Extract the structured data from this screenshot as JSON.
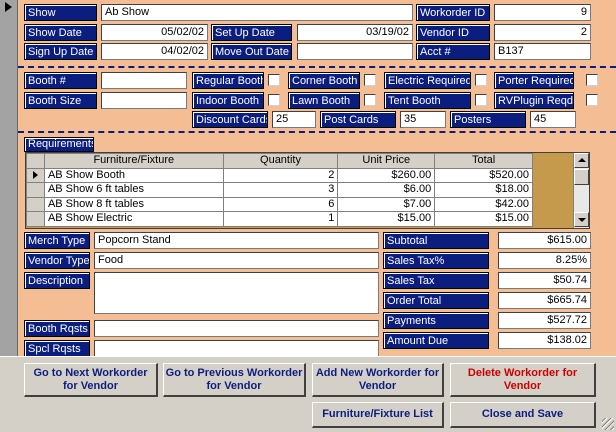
{
  "header": {
    "show_label": "Show",
    "show_value": "Ab Show",
    "workorder_id_label": "Workorder ID",
    "workorder_id_value": "9",
    "show_date_label": "Show Date",
    "show_date_value": "05/02/02",
    "setup_date_label": "Set Up Date",
    "setup_date_value": "03/19/02",
    "vendor_id_label": "Vendor ID",
    "vendor_id_value": "2",
    "signup_date_label": "Sign Up Date",
    "signup_date_value": "04/02/02",
    "moveout_date_label": "Move Out Date",
    "moveout_date_value": "",
    "acct_label": "Acct #",
    "acct_value": "B137"
  },
  "booth": {
    "booth_no_label": "Booth #",
    "booth_no_value": "",
    "booth_size_label": "Booth Size",
    "booth_size_value": "",
    "regular_booth": "Regular Booth",
    "corner_booth": "Corner Booth",
    "electric_required": "Electric Required",
    "porter_required": "Porter Required",
    "indoor_booth": "Indoor Booth",
    "lawn_booth": "Lawn Booth",
    "tent_booth": "Tent Booth",
    "rvplugin_reqd": "RVPlugin Reqd",
    "discount_cards_label": "Discount Cards",
    "discount_cards_value": "25",
    "post_cards_label": "Post Cards",
    "post_cards_value": "35",
    "posters_label": "Posters",
    "posters_value": "45"
  },
  "requirements": {
    "label": "Requirements",
    "columns": [
      "Furniture/Fixture",
      "Quantity",
      "Unit Price",
      "Total"
    ],
    "rows": [
      {
        "item": "AB Show Booth",
        "qty": "2",
        "price": "$260.00",
        "total": "$520.00"
      },
      {
        "item": "AB Show 6 ft tables",
        "qty": "3",
        "price": "$6.00",
        "total": "$18.00"
      },
      {
        "item": "AB Show 8 ft tables",
        "qty": "6",
        "price": "$7.00",
        "total": "$42.00"
      },
      {
        "item": "AB Show Electric",
        "qty": "1",
        "price": "$15.00",
        "total": "$15.00"
      }
    ]
  },
  "details": {
    "merch_type_label": "Merch Type",
    "merch_type_value": "Popcorn Stand",
    "vendor_type_label": "Vendor Type",
    "vendor_type_value": "Food",
    "description_label": "Description",
    "description_value": "",
    "booth_rqsts_label": "Booth Rqsts",
    "booth_rqsts_value": "",
    "spcl_rqsts_label": "Spcl Rqsts",
    "spcl_rqsts_value": ""
  },
  "totals": {
    "subtotal_label": "Subtotal",
    "subtotal_value": "$615.00",
    "sales_tax_pct_label": "Sales Tax%",
    "sales_tax_pct_value": "8.25%",
    "sales_tax_label": "Sales Tax",
    "sales_tax_value": "$50.74",
    "order_total_label": "Order Total",
    "order_total_value": "$665.74",
    "payments_label": "Payments",
    "payments_value": "$527.72",
    "amount_due_label": "Amount Due",
    "amount_due_value": "$138.02"
  },
  "buttons": {
    "next_workorder": "Go to Next Workorder for Vendor",
    "prev_workorder": "Go to Previous Workorder for Vendor",
    "add_workorder": "Add New Workorder for Vendor",
    "delete_workorder": "Delete Workorder for Vendor",
    "furniture_list": "Furniture/Fixture List",
    "close_save": "Close and Save"
  },
  "colors": {
    "background": "#f4bd94",
    "label_bg": "#0b1e80",
    "delete_text": "#cc0000",
    "footer_bg": "#d4d0c8"
  }
}
